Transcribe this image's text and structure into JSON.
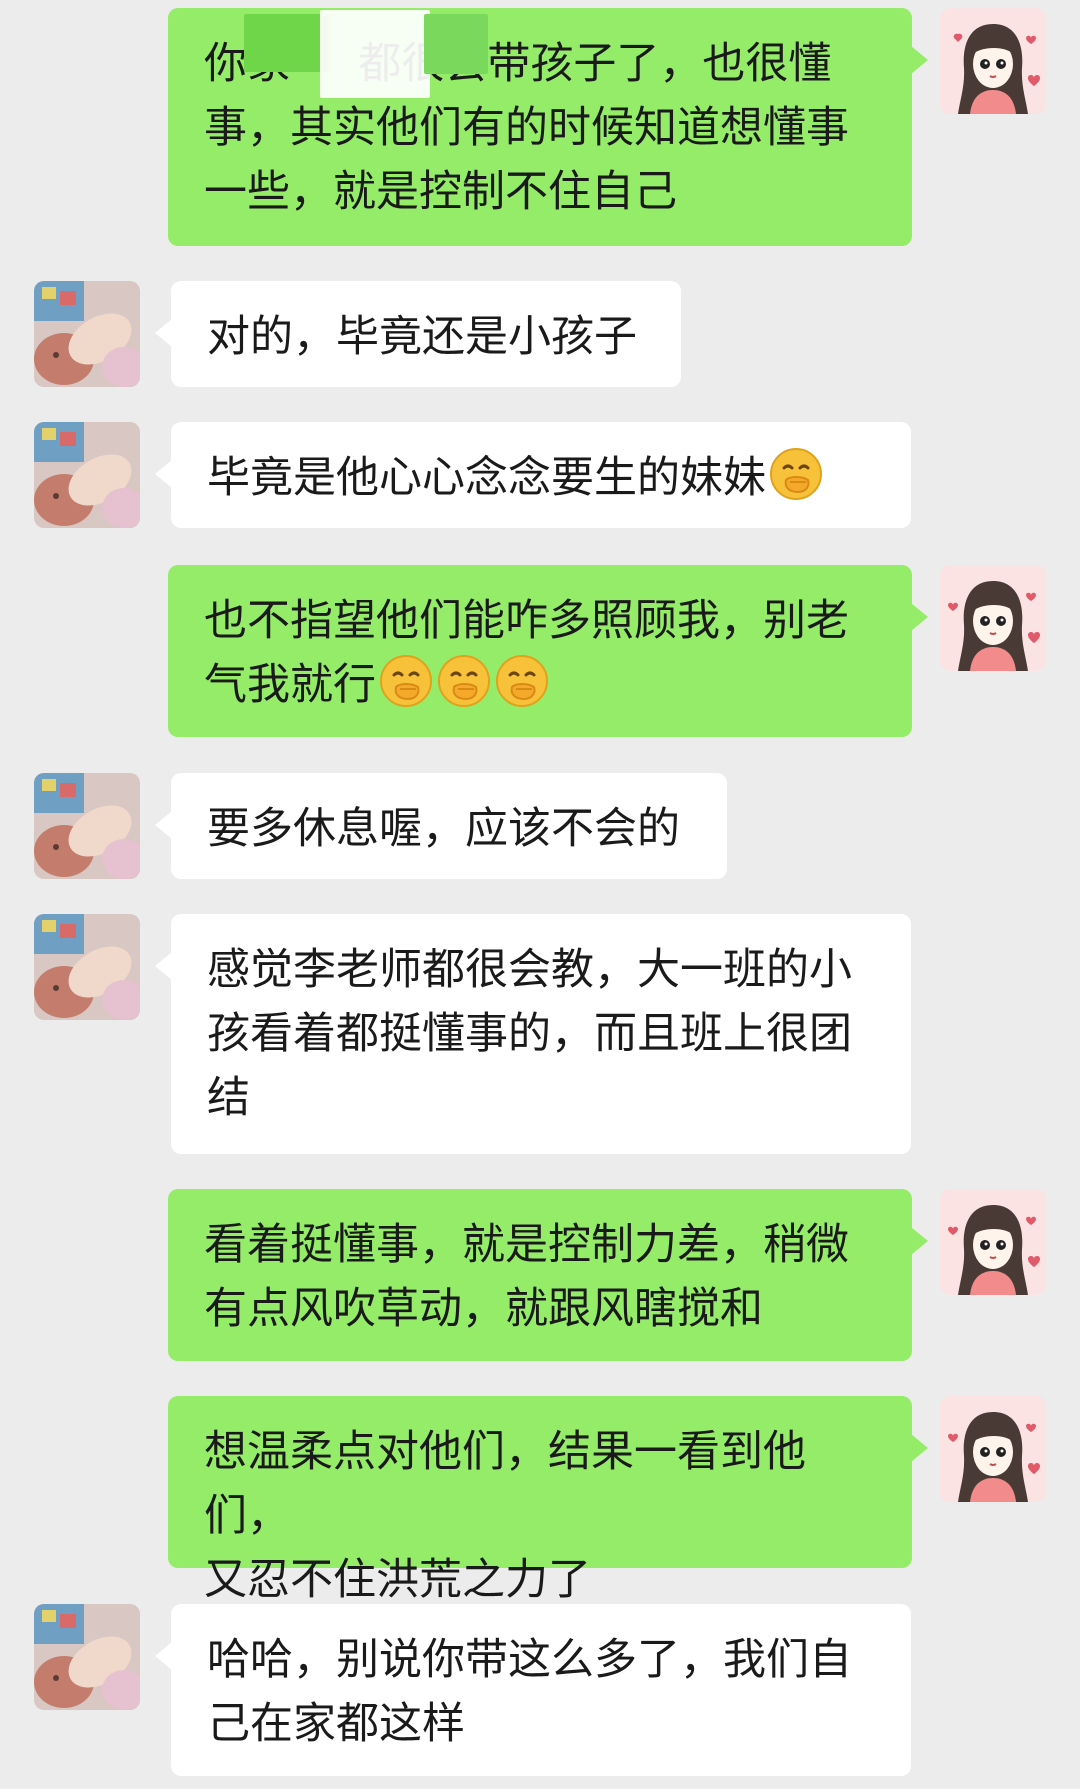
{
  "chat": {
    "messages": [
      {
        "id": "m1",
        "sender": "self",
        "text": "你家□□□□都很会带孩子了，也很懂事，其实他们有的时候知道想懂事一些，就是控制不住自己",
        "display_lines": [
          "你家     都很会带孩子了，也很懂",
          "事，其实他们有的时候知道想懂事",
          "一些，就是控制不住自己"
        ]
      },
      {
        "id": "m2",
        "sender": "other",
        "text": "对的，毕竟还是小孩子"
      },
      {
        "id": "m3",
        "sender": "other",
        "text": "毕竟是他心心念念要生的妹妹",
        "emoji": "hand-over-mouth-emoji",
        "emoji_count": 1
      },
      {
        "id": "m4",
        "sender": "self",
        "text_lines": [
          "也不指望他们能咋多照顾我，别老",
          "气我就行"
        ],
        "emoji": "hand-over-mouth-emoji",
        "emoji_count": 3
      },
      {
        "id": "m5",
        "sender": "other",
        "text": "要多休息喔，应该不会的"
      },
      {
        "id": "m6",
        "sender": "other",
        "text_lines": [
          "感觉李老师都很会教，大一班的小",
          "孩看着都挺懂事的，而且班上很团",
          "结"
        ]
      },
      {
        "id": "m7",
        "sender": "self",
        "text_lines": [
          "看着挺懂事，就是控制力差，稍微",
          "有点风吹草动，就跟风瞎搅和"
        ]
      },
      {
        "id": "m8",
        "sender": "self",
        "text_lines": [
          "想温柔点对他们，结果一看到他们，",
          "又忍不住洪荒之力了"
        ]
      },
      {
        "id": "m9",
        "sender": "other",
        "text_lines": [
          "哈哈，别说你带这么多了，我们自",
          "己在家都这样"
        ]
      }
    ]
  },
  "colors": {
    "background": "#ececec",
    "outgoing_bubble": "#95ec69",
    "incoming_bubble": "#ffffff",
    "text": "#1a1a1a"
  },
  "avatars": {
    "self": "cartoon-girl-avatar",
    "other": "baby-photo-avatar"
  }
}
